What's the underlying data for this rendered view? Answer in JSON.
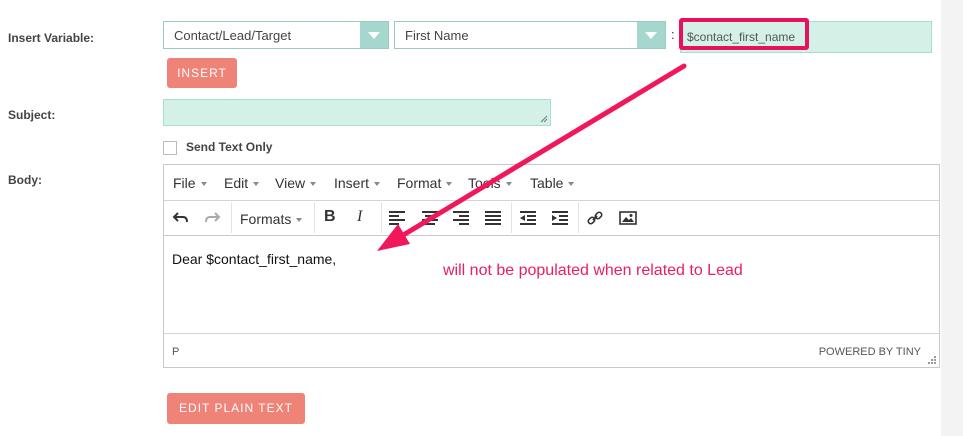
{
  "labels": {
    "insert_variable": "Insert Variable:",
    "subject": "Subject:",
    "body": "Body:"
  },
  "module_select": {
    "value": "Contact/Lead/Target"
  },
  "field_select": {
    "value": "First Name"
  },
  "colon": ":",
  "variable_field": {
    "value": "$contact_first_name"
  },
  "insert_button": "INSERT",
  "send_text_only": "Send Text Only",
  "editor": {
    "menu": [
      "File",
      "Edit",
      "View",
      "Insert",
      "Format",
      "Tools",
      "Table"
    ],
    "formats_label": "Formats",
    "bold": "B",
    "italic": "I",
    "content": "Dear $contact_first_name,",
    "path": "P",
    "powered_by": "POWERED BY TINY"
  },
  "annotation": {
    "text": "will not be populated when related to Lead",
    "color": "#e91e63"
  },
  "edit_plain_text_button": "EDIT PLAIN TEXT",
  "colors": {
    "accent_green": "#d4f1e8",
    "button": "#f08377",
    "select_arrow": "#a5d7cf"
  }
}
